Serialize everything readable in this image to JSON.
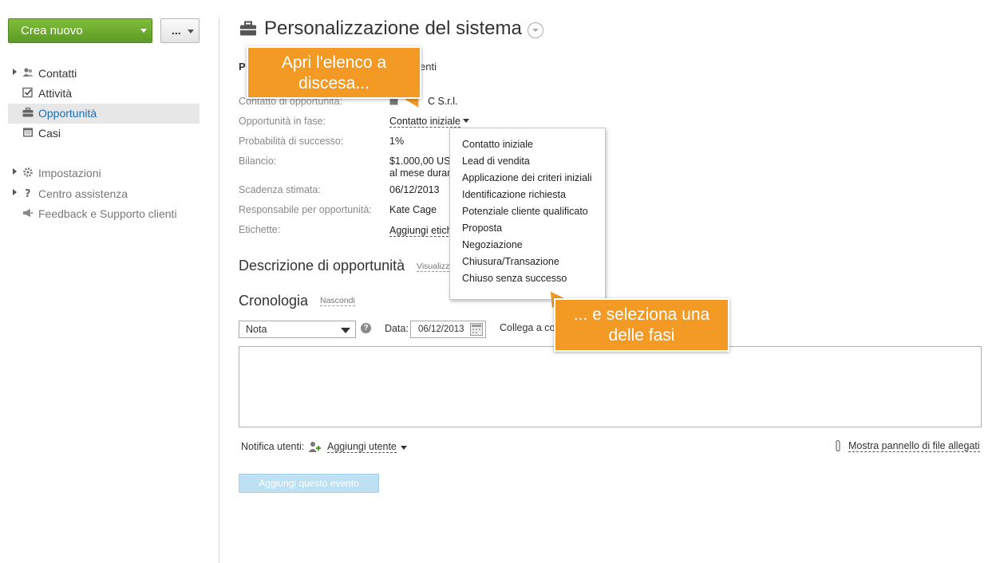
{
  "sidebar": {
    "create_button": "Crea nuovo",
    "more_button": "...",
    "nav": [
      {
        "label": "Contatti",
        "icon": "contacts-icon"
      },
      {
        "label": "Attività",
        "icon": "tasks-icon"
      },
      {
        "label": "Opportunità",
        "icon": "briefcase-icon"
      },
      {
        "label": "Casi",
        "icon": "cases-icon"
      }
    ],
    "secondary": [
      {
        "label": "Impostazioni",
        "icon": "gear-icon"
      },
      {
        "label": "Centro assistenza",
        "icon": "help-icon"
      },
      {
        "label": "Feedback e Supporto clienti",
        "icon": "megaphone-icon"
      }
    ]
  },
  "header": {
    "title": "Personalizzazione del sistema"
  },
  "details": {
    "p_label": "P",
    "p_label_tail": "enti",
    "fields": [
      {
        "label": "Contatto di opportunità:",
        "value": "C S.r.l."
      },
      {
        "label": "Opportunità in fase:",
        "value": "Contatto iniziale"
      },
      {
        "label": "Probabilità di successo:",
        "value": "1%"
      },
      {
        "label": "Bilancio:",
        "value": "$1.000,00 US",
        "value2": "al mese durar"
      },
      {
        "label": "Scadenza stimata:",
        "value": "06/12/2013"
      },
      {
        "label": "Responsabile per opportunità:",
        "value": "Kate Cage"
      },
      {
        "label": "Etichette:",
        "value": "Aggiungi etich"
      }
    ]
  },
  "description": {
    "title": "Descrizione di opportunità",
    "link": "Visualizz"
  },
  "history": {
    "title": "Cronologia",
    "hide_link": "Nascondi",
    "type_value": "Nota",
    "date_label": "Data:",
    "date_value": "06/12/2013",
    "link_label": "Collega a co",
    "notify_label": "Notifica utenti:",
    "add_user": "Aggiungi utente",
    "attach_link": "Mostra pannello di file allegati",
    "add_event_button": "Aggiungi questo evento"
  },
  "dropdown": {
    "options": [
      "Contatto iniziale",
      "Lead di vendita",
      "Applicazione dei criteri iniziali",
      "Identificazione richiesta",
      "Potenziale cliente qualificato",
      "Proposta",
      "Negoziazione",
      "Chiusura/Transazione",
      "Chiuso senza successo"
    ]
  },
  "callouts": {
    "first_line1": "Apri l'elenco a",
    "first_line2": "discesa...",
    "second_line1": "... e seleziona una",
    "second_line2": "delle fasi"
  },
  "colors": {
    "create_button": "#6aaa2d",
    "callout": "#f39a24",
    "active_nav_text": "#1a6fb4",
    "active_nav_bg": "#e7e7e7"
  }
}
